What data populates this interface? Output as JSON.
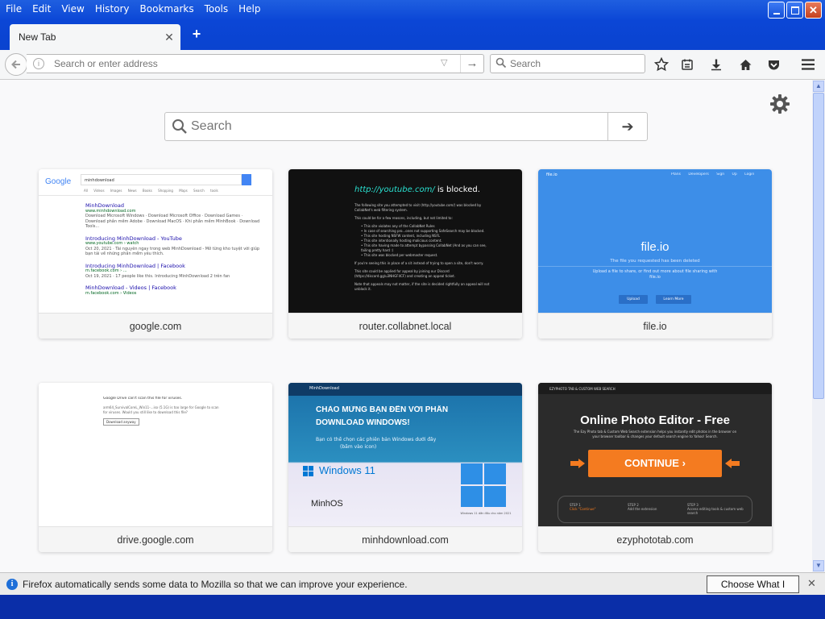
{
  "menu": [
    "File",
    "Edit",
    "View",
    "History",
    "Bookmarks",
    "Tools",
    "Help"
  ],
  "tab": {
    "title": "New Tab"
  },
  "address": {
    "placeholder": "Search or enter address"
  },
  "toolbar_search": {
    "placeholder": "Search"
  },
  "page_search": {
    "placeholder": "Search"
  },
  "tiles": [
    {
      "label": "google.com",
      "preview": {
        "logo": "Google",
        "query": "minhdownload",
        "tabs": [
          "All",
          "Videos",
          "Images",
          "News",
          "Books",
          "Shopping",
          "Maps",
          "Search tools"
        ],
        "results": [
          {
            "title": "MinhDownload",
            "url": "www.minhdownload.com",
            "snippet": "Download Microsoft Windows · Download Microsoft Office · Download Games · Download phần mềm Adobe · Download MacOS · Khi phần mềm MinhBook · Download Tools..."
          },
          {
            "title": "Introducing MinhDownload - YouTube",
            "url": "www.youtube.com › watch",
            "snippet": "Oct 20, 2021 · Tài nguyên ngay trong web MinhDownload - Mở từng kho tuyệt vời giúp bạn tải về những phần mềm yêu thích."
          },
          {
            "title": "Introducing MinhDownload | Facebook",
            "url": "m.facebook.com › ...",
            "snippet": "Oct 19, 2021 · 17 people like this. Introducing MinhDownload 2 trên fan"
          },
          {
            "title": "MinhDownload - Videos | Facebook",
            "url": "m.facebook.com › Videos",
            "snippet": ""
          }
        ]
      }
    },
    {
      "label": "router.collabnet.local",
      "preview": {
        "url": "http://youtube.com/",
        "suffix": " is blocked.",
        "lines": [
          "The following site you attempted to visit (http://youtube.com/) was blocked by CollabNet's web filtering system.",
          "This could be for a few reasons, including, but not limited to:",
          "• This site violates any of the CollabNet Rules",
          "• In case of searching pro...ones not supporting SafeSearch may be blocked.",
          "• This site hosting NSFW content, including NSFL",
          "• This site intentionally hosting malicious content.",
          "• This site having made to attempt bypassing CollabNet (And as you can see, failing pretty hard :)",
          "• This site was blocked per webmaster request.",
          "If you're seeing this in place of a sit instead of trying to open a site, don't worry.",
          "This site could be applied for appeal by joining our Discord (https://discord.gg/u3NHGF4CF) and creating an appeal ticket.",
          "Note that appeals may not matter, if the site is decided rightfully an appeal will not unblock it."
        ]
      }
    },
    {
      "label": "file.io",
      "preview": {
        "brand": "file.io",
        "nav": [
          "Plans",
          "Developers",
          "Sign Up",
          "Login"
        ],
        "title": "file.io",
        "subtitle": "The file you requested has been deleted",
        "desc": "Upload a file to share, or find out more about file sharing with file.io",
        "btn1": "Upload",
        "btn2": "Learn More"
      }
    },
    {
      "label": "drive.google.com",
      "preview": {
        "line1": "Google Drive can't scan this file for viruses.",
        "line2": "arm64_SurvivalCoreL_Win11-...iso (5.1G) is too large for Google to scan for viruses. Would you still like to download this file?",
        "button": "Download anyway"
      }
    },
    {
      "label": "minhdownload.com",
      "preview": {
        "site": "MinhDownload",
        "heading1": "CHÀO MỪNG BẠN ĐẾN VỚI PHẦN",
        "heading2": "DOWNLOAD WINDOWS!",
        "sub1": "Bạn có thể chọn các phiên bản Windows dưới đây",
        "sub2": "(bấm vào icon)",
        "win": "Windows 11",
        "brand": "MinhOS",
        "caption": "Windows 11 dẫn đầu cho năm 2021"
      }
    },
    {
      "label": "ezyphototab.com",
      "preview": {
        "top": "EZYPHOTO TAB & CUSTOM WEB SEARCH",
        "title": "Online Photo Editor - Free",
        "sub": "The Ezy Photo tab & Custom Web Search extension helps you instantly edit photos in the browser on your browser toolbar & changes your default search engine to Yahoo! Search.",
        "cta": "CONTINUE",
        "steps": [
          {
            "n": "STEP 1",
            "t": "Click \"Continue\""
          },
          {
            "n": "STEP 2",
            "t": "Add the extension"
          },
          {
            "n": "STEP 3",
            "t": "Access editing tools & custom web search"
          }
        ]
      }
    }
  ],
  "notification": {
    "text": "Firefox automatically sends some data to Mozilla so that we can improve your experience.",
    "button": "Choose What I Share"
  },
  "colors": {
    "titlebar": "#0b46d6",
    "filelocal_blue": "#3d8ee8",
    "cta_orange": "#f47b20"
  }
}
